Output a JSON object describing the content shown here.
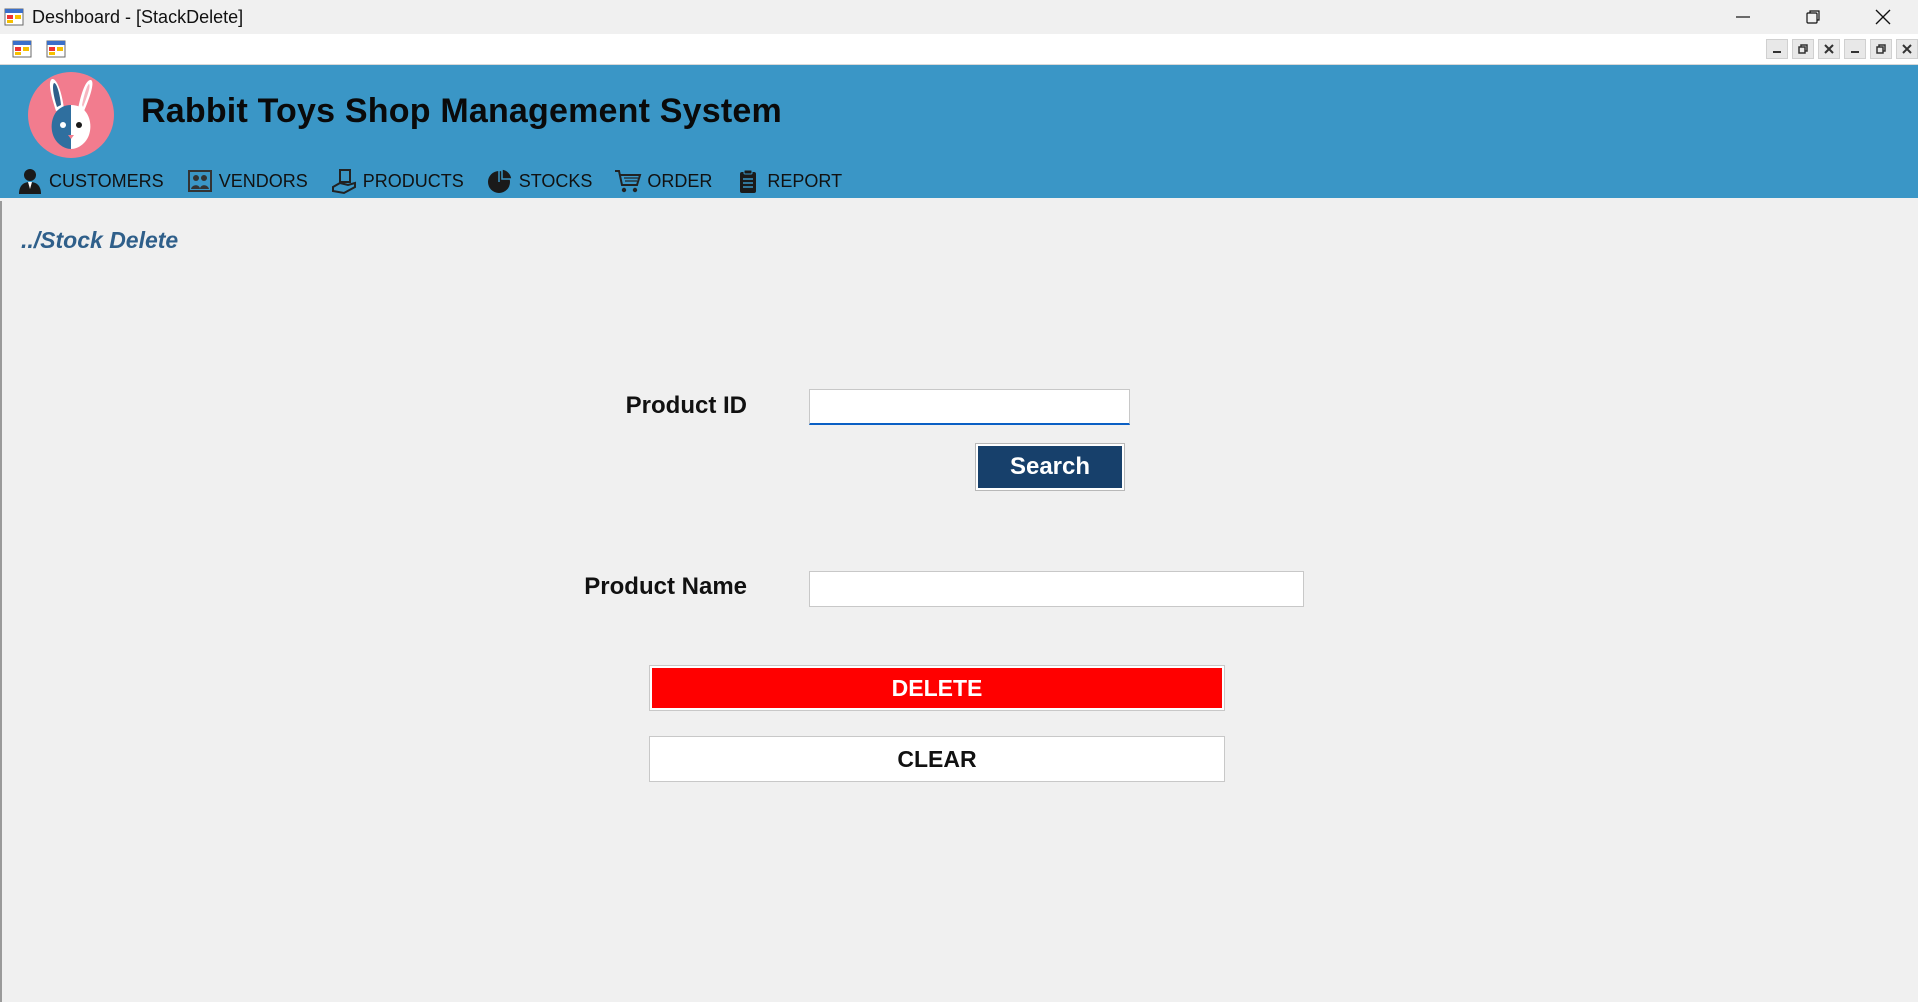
{
  "window": {
    "title": "Deshboard - [StackDelete]",
    "icon": "app-form-icon",
    "controls": [
      "minimize-icon",
      "restore-icon",
      "close-icon"
    ]
  },
  "mdi": {
    "icons": [
      "mdi-form-icon",
      "mdi-form-icon"
    ],
    "controls": [
      "minimize-icon",
      "restore-icon",
      "close-icon",
      "minimize-icon",
      "restore-icon",
      "close-icon"
    ]
  },
  "header": {
    "logo": "rabbit-logo",
    "title": "Rabbit Toys Shop Management System",
    "background": "#3a96c6"
  },
  "nav": {
    "items": [
      {
        "label": "CUSTOMERS",
        "icon": "user-icon"
      },
      {
        "label": "VENDORS",
        "icon": "vendor-icon"
      },
      {
        "label": "PRODUCTS",
        "icon": "product-icon"
      },
      {
        "label": "STOCKS",
        "icon": "pie-chart-icon"
      },
      {
        "label": "ORDER",
        "icon": "cart-icon"
      },
      {
        "label": "REPORT",
        "icon": "clipboard-icon"
      }
    ]
  },
  "page": {
    "breadcrumb": "../Stock Delete",
    "product_id": {
      "label": "Product ID",
      "value": ""
    },
    "search_label": "Search",
    "product_name": {
      "label": "Product Name",
      "value": ""
    },
    "delete_label": "DELETE",
    "clear_label": "CLEAR"
  },
  "colors": {
    "search_button": "#17406b",
    "delete_button": "#ff0000",
    "breadcrumb": "#2f5f8a"
  }
}
